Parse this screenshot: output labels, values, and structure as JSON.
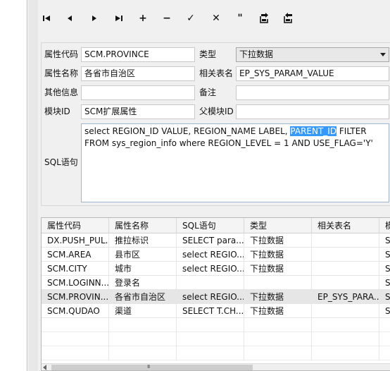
{
  "toolbar": {
    "buttons": [
      {
        "name": "first-record-icon"
      },
      {
        "name": "previous-record-icon"
      },
      {
        "name": "next-record-icon"
      },
      {
        "name": "last-record-icon"
      },
      {
        "name": "add-icon",
        "glyph": "+"
      },
      {
        "name": "delete-icon",
        "glyph": "−"
      },
      {
        "name": "confirm-icon",
        "glyph": "✓"
      },
      {
        "name": "cancel-icon",
        "glyph": "✕"
      },
      {
        "name": "refresh-icon",
        "glyph": "\""
      },
      {
        "name": "export-icon"
      },
      {
        "name": "import-icon"
      }
    ]
  },
  "form": {
    "attr_code_label": "属性代码",
    "attr_code_value": "SCM.PROVINCE",
    "type_label": "类型",
    "type_value": "下拉数据",
    "attr_name_label": "属性名称",
    "attr_name_value": "各省市自治区",
    "related_table_label": "相关表名",
    "related_table_value": "EP_SYS_PARAM_VALUE",
    "other_info_label": "其他信息",
    "other_info_value": "",
    "remark_label": "备注",
    "remark_value": "",
    "module_id_label": "模块ID",
    "module_id_value": "SCM扩展属性",
    "parent_module_id_label": "父模块ID",
    "parent_module_id_value": "",
    "sql_label": "SQL语句",
    "sql_before": "select REGION_ID VALUE, REGION_NAME LABEL, ",
    "sql_selected": "PARENT_ID",
    "sql_after": " FILTER FROM sys_region_info where REGION_LEVEL = 1 AND USE_FLAG='Y'"
  },
  "grid": {
    "columns": [
      "属性代码",
      "属性名称",
      "SQL语句",
      "类型",
      "相关表名",
      "模"
    ],
    "rows": [
      [
        "DX.PUSH_PUL...",
        "推拉标识",
        "SELECT para...",
        "下拉数据",
        "",
        "S"
      ],
      [
        "SCM.AREA",
        "县市区",
        "select REGIO...",
        "下拉数据",
        "",
        "S"
      ],
      [
        "SCM.CITY",
        "城市",
        "select REGIO...",
        "下拉数据",
        "",
        "S"
      ],
      [
        "SCM.LOGINN...",
        "登录名",
        "",
        "",
        "",
        "S"
      ],
      [
        "SCM.PROVIN...",
        "各省市自治区",
        "select REGIO...",
        "下拉数据",
        "EP_SYS_PARA...",
        "S"
      ],
      [
        "SCM.QUDAO",
        "渠道",
        "SELECT T.CH...",
        "下拉数据",
        "",
        "S"
      ]
    ],
    "selected_row": 4,
    "scroll_grip": "III"
  }
}
